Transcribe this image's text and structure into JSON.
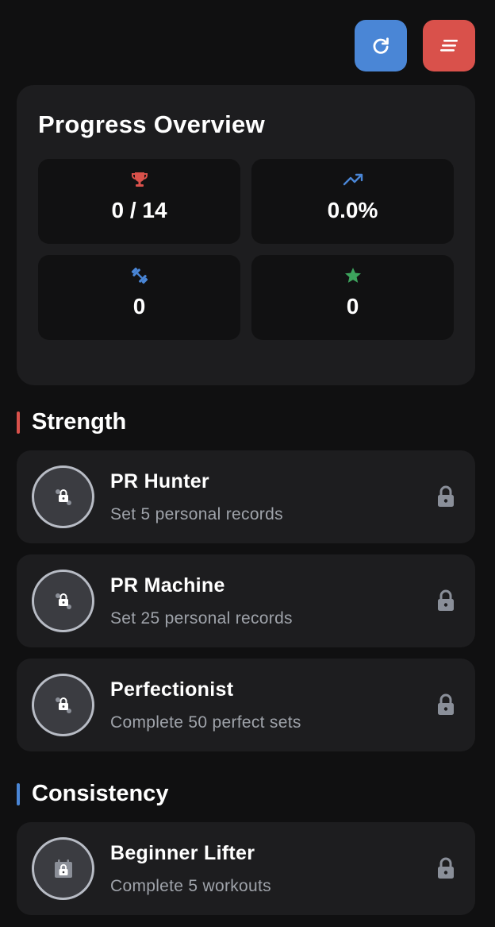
{
  "toolbar": {
    "refresh_icon": "refresh-icon",
    "sort_icon": "sort-icon"
  },
  "overview": {
    "title": "Progress Overview",
    "stats": [
      {
        "icon": "trophy-icon",
        "color": "#d9514b",
        "value": "0 / 14"
      },
      {
        "icon": "trending-up-icon",
        "color": "#4a86d6",
        "value": "0.0%"
      },
      {
        "icon": "dumbbell-icon",
        "color": "#4a86d6",
        "value": "0"
      },
      {
        "icon": "star-icon",
        "color": "#3da35d",
        "value": "0"
      }
    ]
  },
  "sections": [
    {
      "title": "Strength",
      "accent": "#d9514b",
      "items": [
        {
          "title": "PR Hunter",
          "description": "Set 5 personal records",
          "icon": "locked-medal-icon",
          "status": "locked"
        },
        {
          "title": "PR Machine",
          "description": "Set 25 personal records",
          "icon": "locked-medal-icon",
          "status": "locked"
        },
        {
          "title": "Perfectionist",
          "description": "Complete 50 perfect sets",
          "icon": "locked-medal-icon",
          "status": "locked"
        }
      ]
    },
    {
      "title": "Consistency",
      "accent": "#4a86d6",
      "items": [
        {
          "title": "Beginner Lifter",
          "description": "Complete 5 workouts",
          "icon": "locked-calendar-icon",
          "status": "locked"
        }
      ]
    }
  ]
}
